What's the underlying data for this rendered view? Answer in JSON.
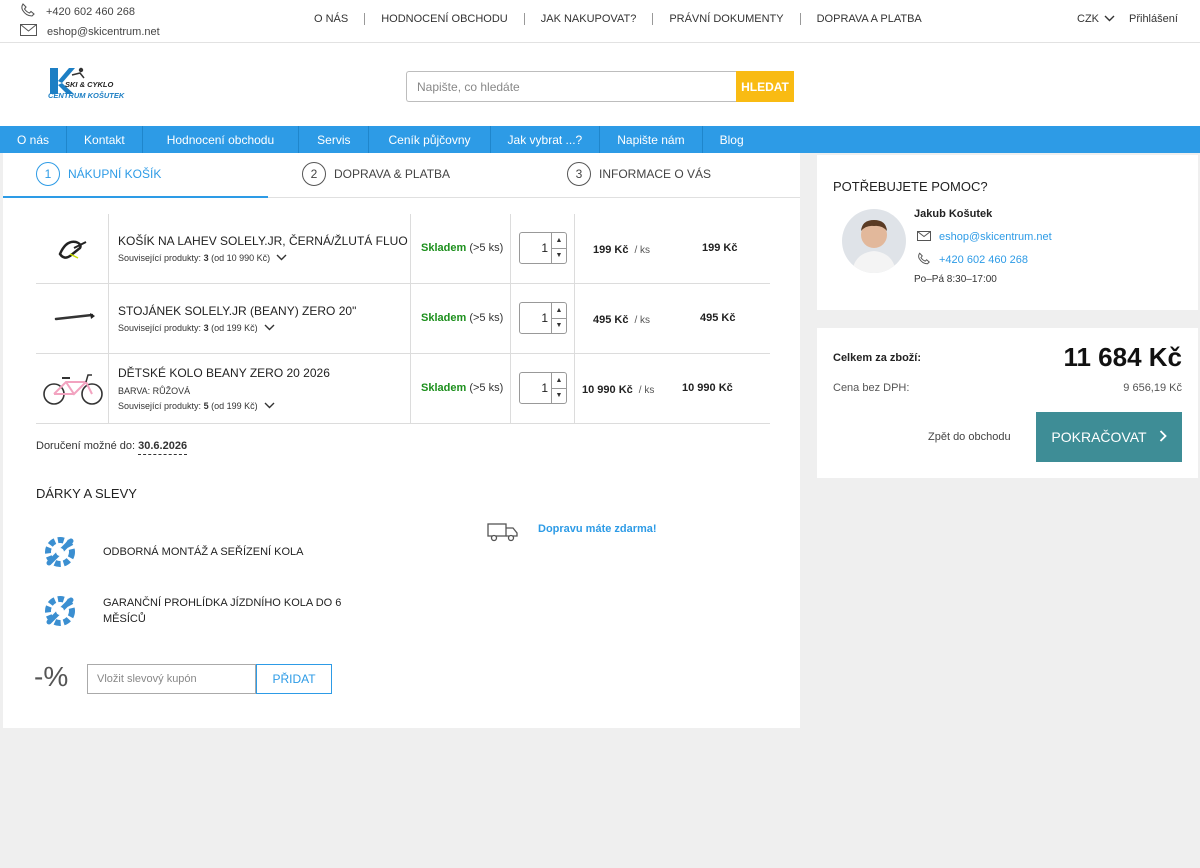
{
  "top": {
    "phone": "+420 602 460 268",
    "email": "eshop@skicentrum.net",
    "nav": [
      "O NÁS",
      "HODNOCENÍ OBCHODU",
      "JAK NAKUPOVAT?",
      "PRÁVNÍ DOKUMENTY",
      "DOPRAVA A PLATBA"
    ],
    "currency": "CZK",
    "login": "Přihlášení"
  },
  "header": {
    "logo_line1": "SKI & CYKLO",
    "logo_line2": "CENTRUM KOŠUTEK",
    "search_placeholder": "Napište, co hledáte",
    "search_button": "HLEDAT"
  },
  "mainnav": [
    "O nás",
    "Kontakt",
    "Hodnocení obchodu",
    "Servis",
    "Ceník půjčovny",
    "Jak vybrat ...?",
    "Napište nám",
    "Blog"
  ],
  "steps": [
    {
      "num": "1",
      "label": "NÁKUPNÍ KOŠÍK"
    },
    {
      "num": "2",
      "label": "DOPRAVA & PLATBA"
    },
    {
      "num": "3",
      "label": "INFORMACE O VÁS"
    }
  ],
  "cart": {
    "items": [
      {
        "name": "KOŠÍK NA LAHEV SOLELY.JR, ČERNÁ/ŽLUTÁ FLUO",
        "variant": "",
        "related_label": "Související produkty:",
        "related_count": "3",
        "related_from": "(od 10 990 Kč)",
        "stock": "Skladem",
        "stock_qty": "(>5 ks)",
        "qty": "1",
        "unit_price": "199 Kč",
        "per": "/ ks",
        "total": "199 Kč"
      },
      {
        "name": "STOJÁNEK SOLELY.JR (BEANY) ZERO 20\"",
        "variant": "",
        "related_label": "Související produkty:",
        "related_count": "3",
        "related_from": "(od 199 Kč)",
        "stock": "Skladem",
        "stock_qty": "(>5 ks)",
        "qty": "1",
        "unit_price": "495 Kč",
        "per": "/ ks",
        "total": "495 Kč"
      },
      {
        "name": "DĚTSKÉ KOLO BEANY ZERO 20 2026",
        "variant": "BARVA: RŮŽOVÁ",
        "related_label": "Související produkty:",
        "related_count": "5",
        "related_from": "(od 199 Kč)",
        "stock": "Skladem",
        "stock_qty": "(>5 ks)",
        "qty": "1",
        "unit_price": "10 990 Kč",
        "per": "/ ks",
        "total": "10 990 Kč"
      }
    ],
    "delivery_label": "Doručení možné do:",
    "delivery_date": "30.6.2026"
  },
  "gifts": {
    "title": "DÁRKY A SLEVY",
    "items": [
      "ODBORNÁ MONTÁŽ A SEŘÍZENÍ KOLA",
      "GARANČNÍ PROHLÍDKA JÍZDNÍHO KOLA DO 6 MĚSÍCŮ"
    ],
    "free_shipping": "Dopravu máte zdarma!",
    "coupon_symbol": "-%",
    "coupon_placeholder": "Vložit slevový kupón",
    "coupon_button": "PŘIDAT"
  },
  "help": {
    "title": "POTŘEBUJETE POMOC?",
    "name": "Jakub Košutek",
    "email": "eshop@skicentrum.net",
    "phone": "+420 602 460 268",
    "hours": "Po–Pá 8:30–17:00"
  },
  "summary": {
    "total_label": "Celkem za zboží:",
    "total_value": "11 684 Kč",
    "net_label": "Cena bez DPH:",
    "net_value": "9 656,19 Kč",
    "back_link": "Zpět do obchodu",
    "continue_button": "POKRAČOVAT"
  },
  "colors": {
    "accent": "#2d9be6",
    "search_button": "#f9bb13",
    "continue_button": "#3e8d96",
    "in_stock": "#1c8f1c"
  }
}
